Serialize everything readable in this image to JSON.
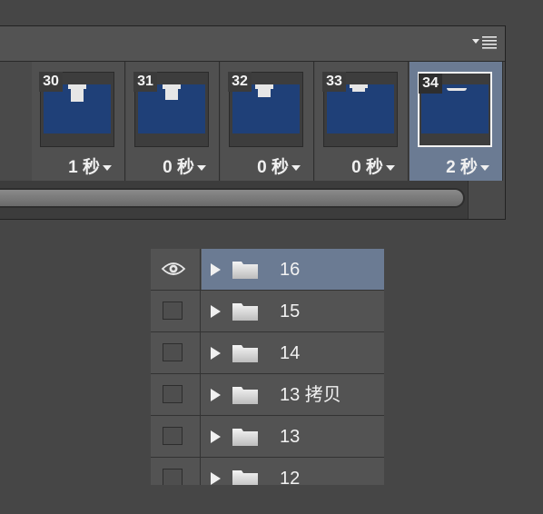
{
  "timeline": {
    "frames": [
      {
        "number": "30",
        "delay": "1 秒",
        "selected": false
      },
      {
        "number": "31",
        "delay": "0 秒",
        "selected": false
      },
      {
        "number": "32",
        "delay": "0 秒",
        "selected": false
      },
      {
        "number": "33",
        "delay": "0 秒",
        "selected": false
      },
      {
        "number": "34",
        "delay": "2 秒",
        "selected": true
      }
    ]
  },
  "layers": {
    "items": [
      {
        "name": "16",
        "visible": true,
        "selected": true
      },
      {
        "name": "15",
        "visible": false,
        "selected": false
      },
      {
        "name": "14",
        "visible": false,
        "selected": false
      },
      {
        "name": "13 拷贝",
        "visible": false,
        "selected": false
      },
      {
        "name": "13",
        "visible": false,
        "selected": false
      },
      {
        "name": "12",
        "visible": false,
        "selected": false
      }
    ]
  },
  "colors": {
    "panel_bg": "#464646",
    "selection": "#6b7b93",
    "thumbnail_blue": "#1f4078"
  },
  "icons": [
    "panel-menu-icon",
    "eye-icon",
    "expand-triangle-icon",
    "folder-icon",
    "dropdown-arrow-icon"
  ]
}
